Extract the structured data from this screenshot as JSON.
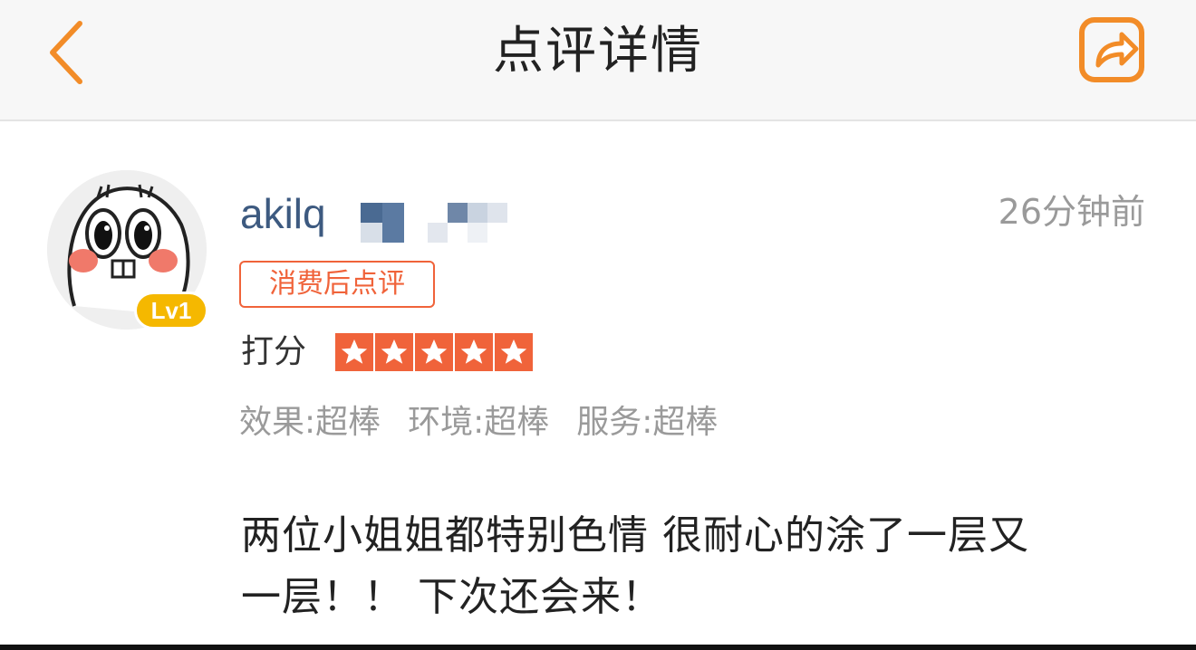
{
  "header": {
    "title": "点评详情",
    "back_icon": "chevron-left-icon",
    "share_icon": "share-icon",
    "accent_color": "#f28c28"
  },
  "review": {
    "user": {
      "name": "akilq",
      "level": "Lv1",
      "avatar_icon": "cartoon-face-avatar"
    },
    "time": "26分钟前",
    "badge": "消费后点评",
    "rating_label": "打分",
    "rating": 5,
    "rating_max": 5,
    "sub_ratings": [
      "效果:超棒",
      "环境:超棒",
      "服务:超棒"
    ],
    "text_line1": "两位小姐姐都特别色情 很耐心的涂了一层又",
    "text_line2": "一层！！ 下次还会来！"
  },
  "colors": {
    "brand_orange": "#f0633a",
    "username_blue": "#3d5a80",
    "muted_gray": "#9a9a9a",
    "level_yellow": "#f5b800"
  }
}
